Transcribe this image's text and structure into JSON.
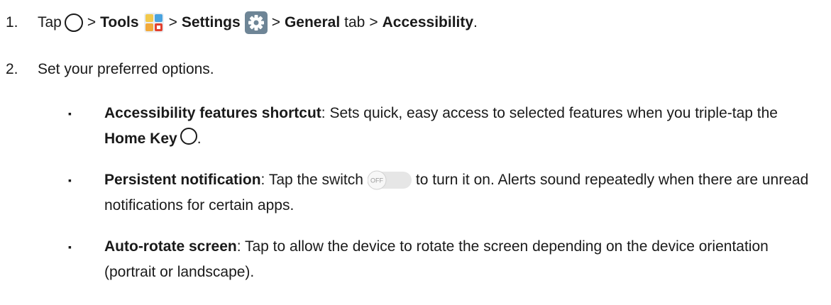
{
  "step1": {
    "number": "1.",
    "tap": "Tap",
    "sep": ">",
    "tools": "Tools",
    "settings": "Settings",
    "general": "General",
    "tab_word": "tab",
    "accessibility": "Accessibility",
    "period": "."
  },
  "step2": {
    "number": "2.",
    "text": "Set your preferred options."
  },
  "bullets": [
    {
      "title": "Accessibility features shortcut",
      "text_a": ": Sets quick, easy access to selected features when you triple-tap the ",
      "bold_b": "Home Key",
      "text_c": "."
    },
    {
      "title": "Persistent notification",
      "text_a": ": Tap the switch",
      "toggle_label": "OFF",
      "text_b": "to turn it on. Alerts sound repeatedly when there are unread notifications for certain apps."
    },
    {
      "title": "Auto-rotate screen",
      "text_a": ": Tap to allow the device to rotate the screen depending on the device orientation (portrait or landscape)."
    }
  ],
  "bullet_symbol": "▪",
  "icons": {
    "home": "home-key-icon",
    "tools": "tools-folder-icon",
    "settings": "settings-gear-icon",
    "toggle": "toggle-switch-icon"
  },
  "colors": {
    "settings_bg": "#6e8596",
    "tools_yellow": "#f2c94c",
    "tools_blue": "#4aa3df",
    "tools_red": "#e2412f",
    "toggle_track": "#e6e6e6"
  }
}
